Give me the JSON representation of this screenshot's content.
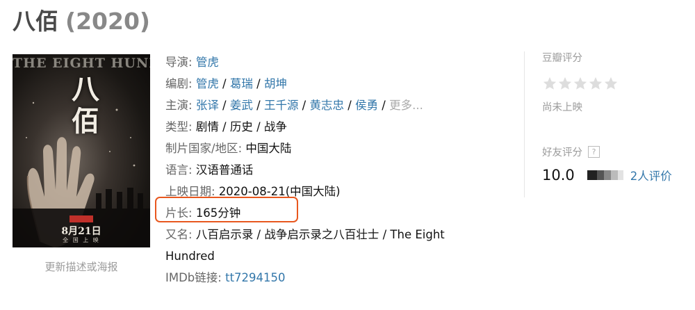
{
  "movie": {
    "title": "八佰",
    "year": "(2020)"
  },
  "poster": {
    "title_en": "THE EIGHT HUNDRED",
    "title_cn": "八佰",
    "release_date": "8月21日",
    "release_sub": "全 国 上 映",
    "update_link": "更新描述或海报"
  },
  "info": {
    "director_label": "导演",
    "directors": [
      "管虎"
    ],
    "writer_label": "编剧",
    "writers": [
      "管虎",
      "葛瑞",
      "胡坤"
    ],
    "cast_label": "主演",
    "cast": [
      "张译",
      "姜武",
      "王千源",
      "黄志忠",
      "侯勇"
    ],
    "cast_more": "更多...",
    "genre_label": "类型",
    "genres": "剧情 / 历史 / 战争",
    "country_label": "制片国家/地区",
    "country": "中国大陆",
    "language_label": "语言",
    "language": "汉语普通话",
    "release_label": "上映日期",
    "release": "2020-08-21(中国大陆)",
    "runtime_label": "片长",
    "runtime": "165分钟",
    "aka_label": "又名",
    "aka": "八百启示录 / 战争启示录之八百壮士 / The Eight Hundred",
    "imdb_label": "IMDb链接",
    "imdb_id": "tt7294150"
  },
  "rating": {
    "section_label": "豆瓣评分",
    "stars_filled": 0,
    "status": "尚未上映",
    "friend_label": "好友评分",
    "help_glyph": "?",
    "friend_score": "10.0",
    "friend_count": "2人评价"
  },
  "colors": {
    "link": "#3377aa",
    "highlight_border": "#e8571e",
    "star_empty": "#dddddd"
  }
}
